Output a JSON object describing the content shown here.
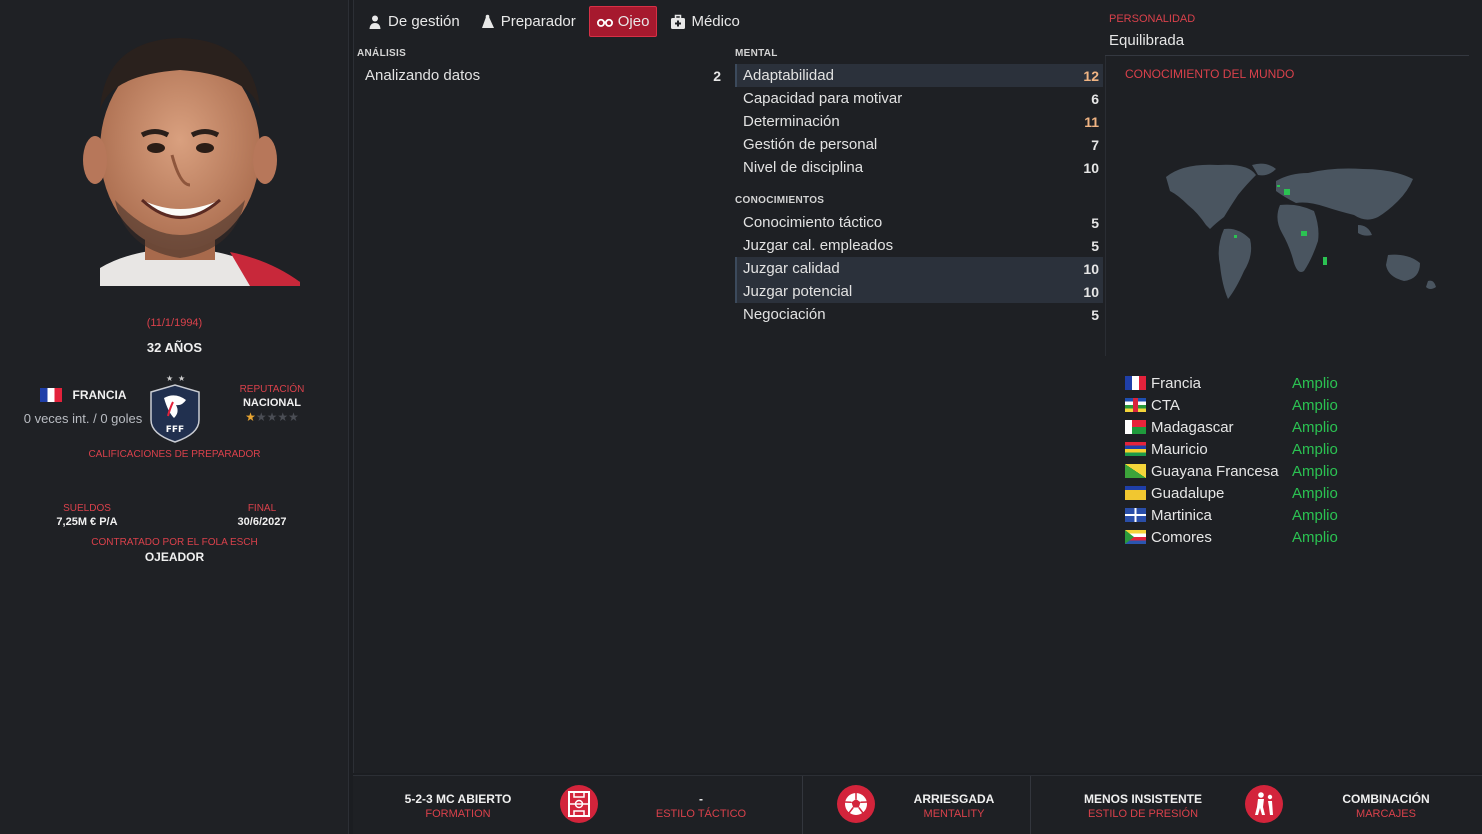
{
  "profile": {
    "birth_date": "(11/1/1994)",
    "age": "32 AÑOS",
    "nation": "FRANCIA",
    "caps": "0 veces int. / 0 goles",
    "reputation_label": "REPUTACIÓN",
    "reputation_value": "NACIONAL",
    "reputation_stars": 1,
    "coach_ratings": "CALIFICACIONES DE PREPARADOR",
    "wage_label": "SUELDOS",
    "wage_value": "7,25M € P/A",
    "end_label": "FINAL",
    "end_value": "30/6/2027",
    "contract_label": "CONTRATADO POR EL FOLA ESCH",
    "contract_role": "OJEADOR"
  },
  "tabs": [
    {
      "label": "De gestión",
      "icon": "person-icon",
      "active": false
    },
    {
      "label": "Preparador",
      "icon": "whistle-icon",
      "active": false
    },
    {
      "label": "Ojeo",
      "icon": "binoculars-icon",
      "active": true
    },
    {
      "label": "Médico",
      "icon": "medical-kit-icon",
      "active": false
    }
  ],
  "analysis": {
    "label": "ANÁLISIS",
    "rows": [
      {
        "name": "Analizando datos",
        "value": "2"
      }
    ]
  },
  "mental": {
    "label": "MENTAL",
    "rows": [
      {
        "name": "Adaptabilidad",
        "value": "12"
      },
      {
        "name": "Capacidad para motivar",
        "value": "6"
      },
      {
        "name": "Determinación",
        "value": "11"
      },
      {
        "name": "Gestión de personal",
        "value": "7"
      },
      {
        "name": "Nivel de disciplina",
        "value": "10"
      }
    ]
  },
  "knowledge": {
    "label": "CONOCIMIENTOS",
    "rows": [
      {
        "name": "Conocimiento táctico",
        "value": "5"
      },
      {
        "name": "Juzgar cal. empleados",
        "value": "5"
      },
      {
        "name": "Juzgar calidad",
        "value": "10"
      },
      {
        "name": "Juzgar potencial",
        "value": "10"
      },
      {
        "name": "Negociación",
        "value": "5"
      }
    ]
  },
  "personality": {
    "label": "PERSONALIDAD",
    "value": "Equilibrada"
  },
  "world_knowledge": {
    "label": "CONOCIMIENTO DEL MUNDO",
    "countries": [
      {
        "name": "Francia",
        "level": "Amplio",
        "flag": "france"
      },
      {
        "name": "CTA",
        "level": "Amplio",
        "flag": "car"
      },
      {
        "name": "Madagascar",
        "level": "Amplio",
        "flag": "madagascar"
      },
      {
        "name": "Mauricio",
        "level": "Amplio",
        "flag": "mauritius"
      },
      {
        "name": "Guayana Francesa",
        "level": "Amplio",
        "flag": "french-guiana"
      },
      {
        "name": "Guadalupe",
        "level": "Amplio",
        "flag": "guadeloupe"
      },
      {
        "name": "Martinica",
        "level": "Amplio",
        "flag": "martinique"
      },
      {
        "name": "Comores",
        "level": "Amplio",
        "flag": "comoros"
      }
    ]
  },
  "bottom": {
    "formation_title": "5-2-3 MC ABIERTO",
    "formation_sub": "FORMATION",
    "style_title": "-",
    "style_sub": "ESTILO TÁCTICO",
    "mentality_title": "ARRIESGADA",
    "mentality_sub": "MENTALITY",
    "pressing_title": "MENOS INSISTENTE",
    "pressing_sub": "ESTILO DE PRESIÓN",
    "marking_title": "COMBINACIÓN",
    "marking_sub": "MARCAJES"
  },
  "colors": {
    "accent": "#d9414b",
    "active_tab": "#a6192e",
    "positive": "#2bc252",
    "high_value": "#f0b483"
  }
}
